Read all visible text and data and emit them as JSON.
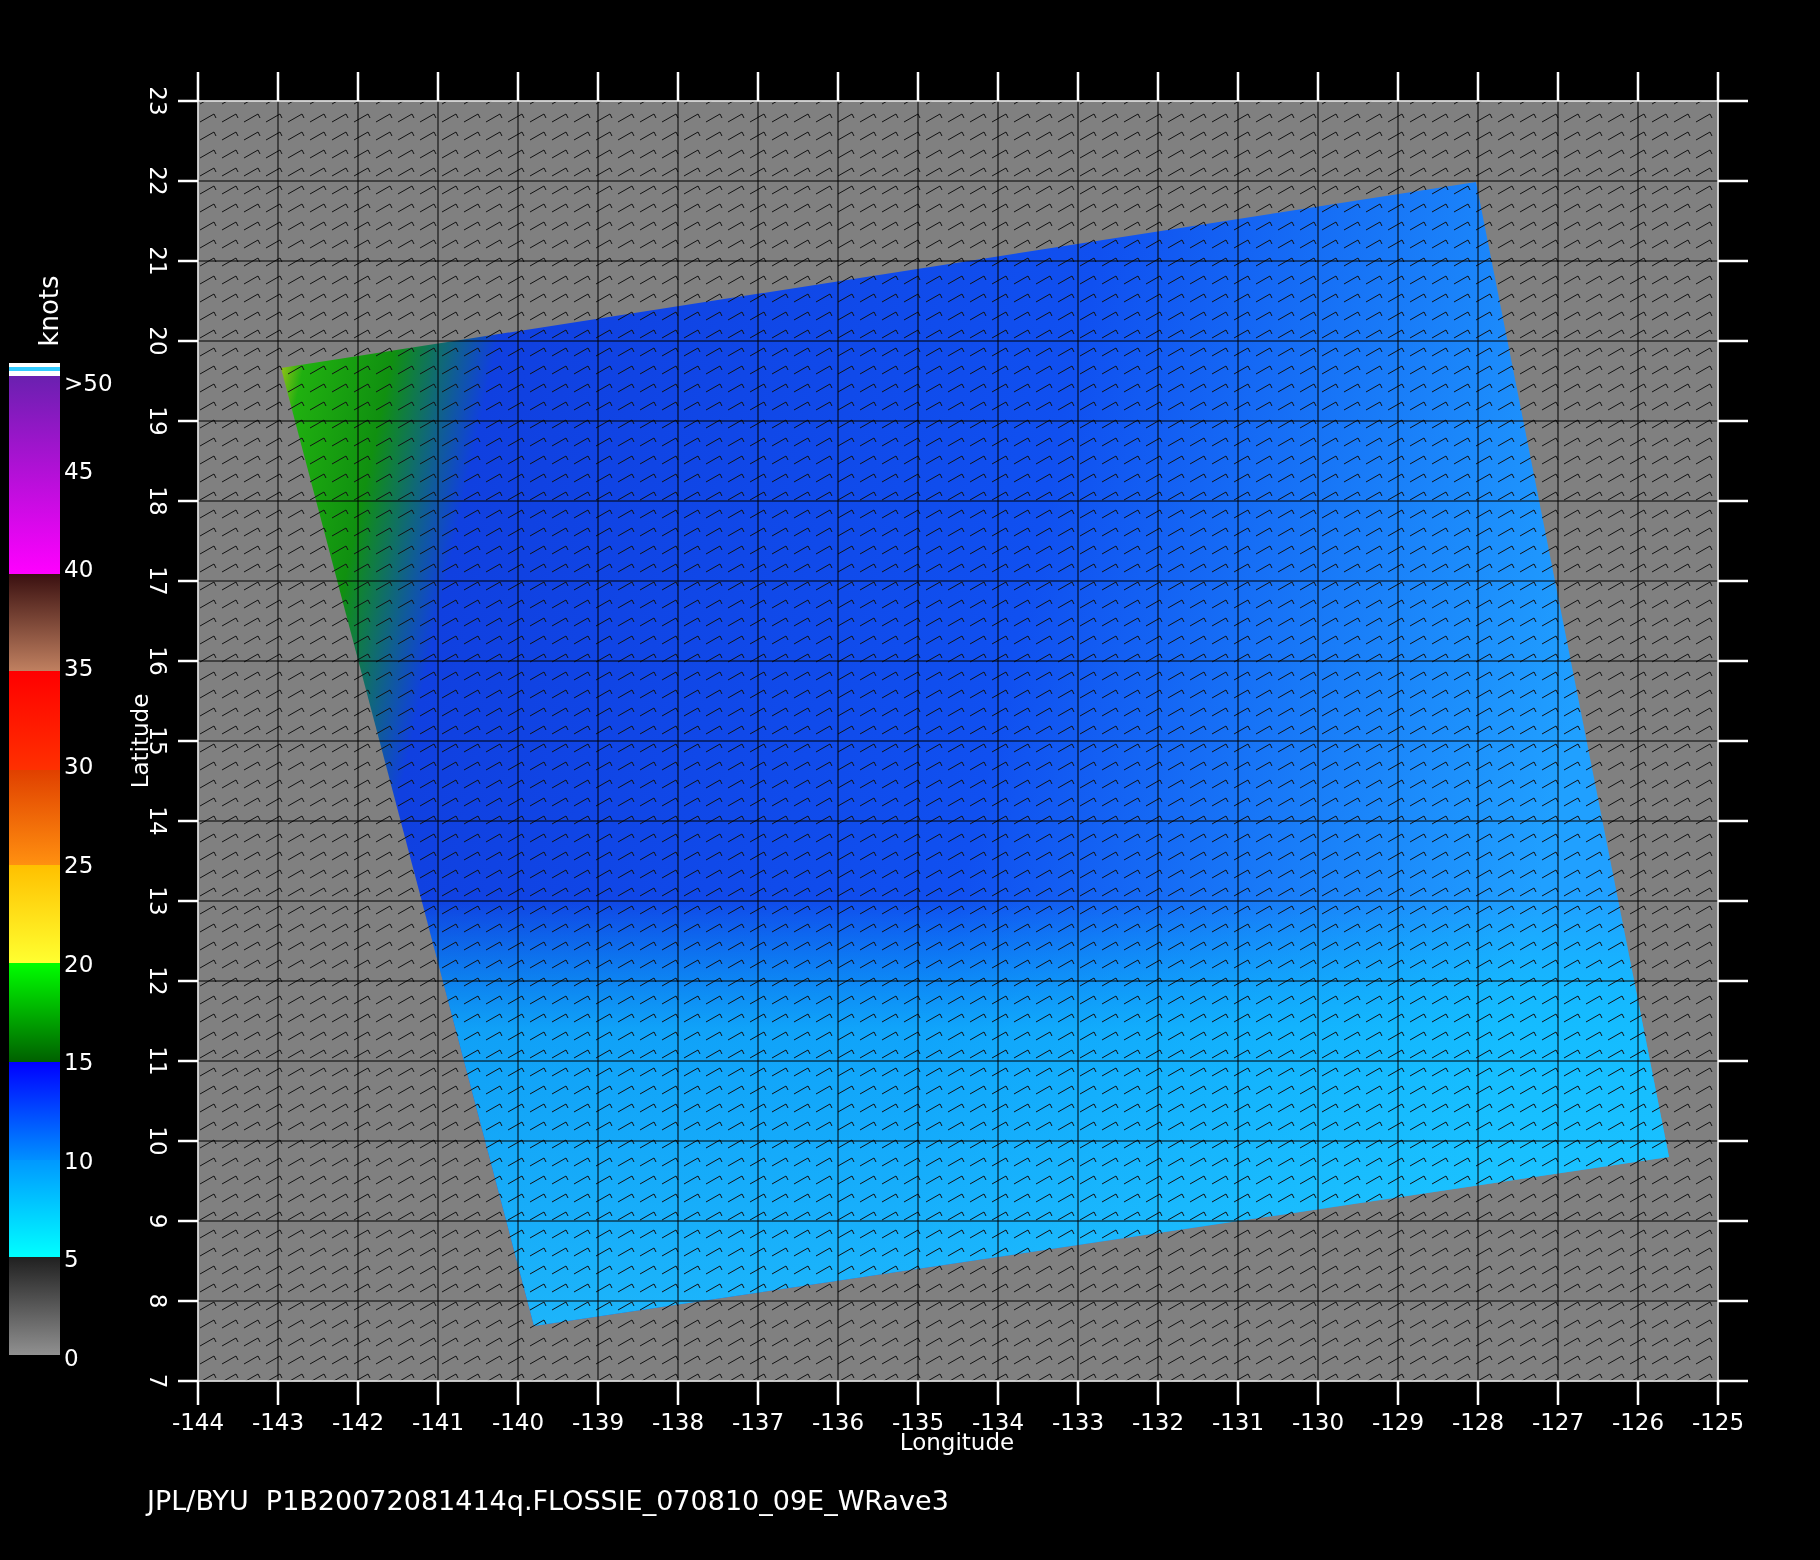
{
  "map": {
    "xaxis": {
      "label": "Longitude",
      "ticks": [
        "-144",
        "-143",
        "-142",
        "-141",
        "-140",
        "-139",
        "-138",
        "-137",
        "-136",
        "-135",
        "-134",
        "-133",
        "-132",
        "-131",
        "-130",
        "-129",
        "-128",
        "-127",
        "-126",
        "-125"
      ]
    },
    "yaxis": {
      "label": "Latitude",
      "ticks": [
        "7",
        "8",
        "9",
        "10",
        "11",
        "12",
        "13",
        "14",
        "15",
        "16",
        "17",
        "18",
        "19",
        "20",
        "21",
        "22",
        "23"
      ]
    }
  },
  "colorbar": {
    "unit": "knots",
    "labels": [
      ">50",
      "45",
      "40",
      "35",
      "30",
      "25",
      "20",
      "15",
      "10",
      "5",
      "0"
    ]
  },
  "footer": "JPL/BYU  P1B20072081414q.FLOSSIE_070810_09E_WRave3"
}
